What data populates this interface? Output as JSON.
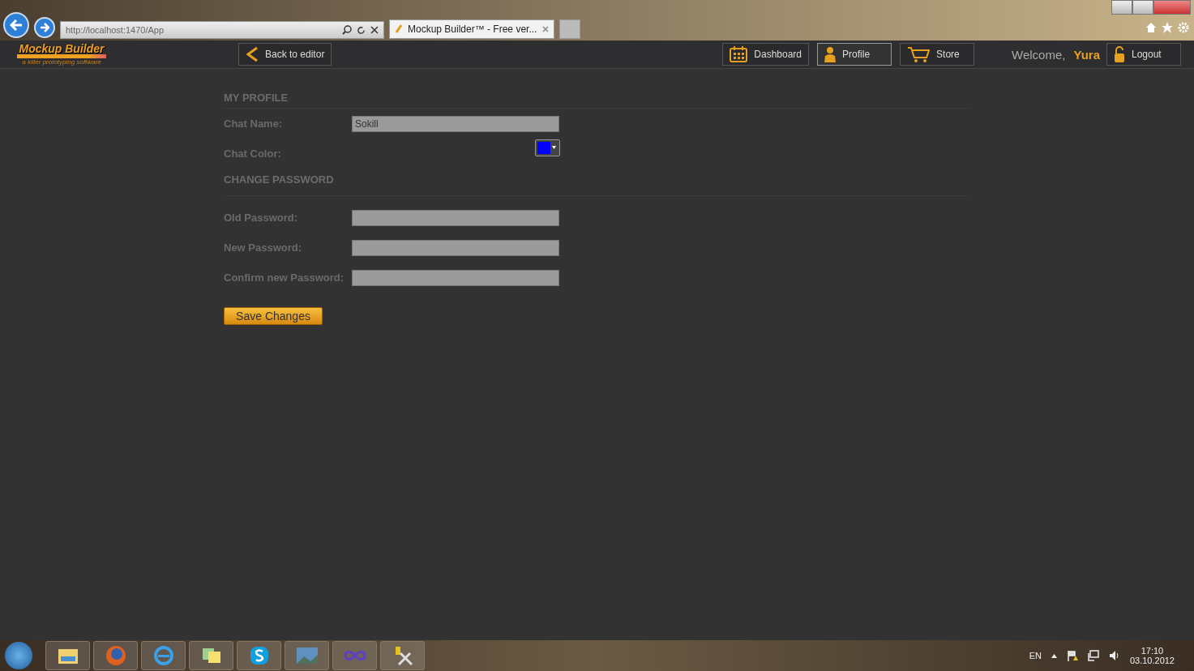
{
  "browser": {
    "address": "http://localhost:1470/App",
    "tab_title": "Mockup Builder™ - Free ver..."
  },
  "header": {
    "logo": "Mockup Builder",
    "tagline": "a killer prototyping software",
    "back_button": "Back to editor",
    "nav": [
      {
        "label": "Dashboard",
        "kind": "calendar",
        "selected": false
      },
      {
        "label": "Profile",
        "kind": "person",
        "selected": true
      },
      {
        "label": "Store",
        "kind": "cart",
        "selected": false
      }
    ],
    "welcome": "Welcome,",
    "user": "Yura",
    "logout": "Logout"
  },
  "profile": {
    "heading": "MY PROFILE",
    "chat_name": {
      "label": "Chat Name:",
      "value": "Sokill"
    },
    "chat_color": {
      "label": "Chat Color:",
      "color": "#0000ff"
    }
  },
  "password": {
    "heading": "CHANGE PASSWORD",
    "fields": [
      {
        "label": "Old Password:"
      },
      {
        "label": "New Password:"
      },
      {
        "label": "Confirm new Password:"
      }
    ]
  },
  "save_button": "Save Changes",
  "taskbar": {
    "language": "EN",
    "time": "17:10",
    "date": "03.10.2012"
  }
}
